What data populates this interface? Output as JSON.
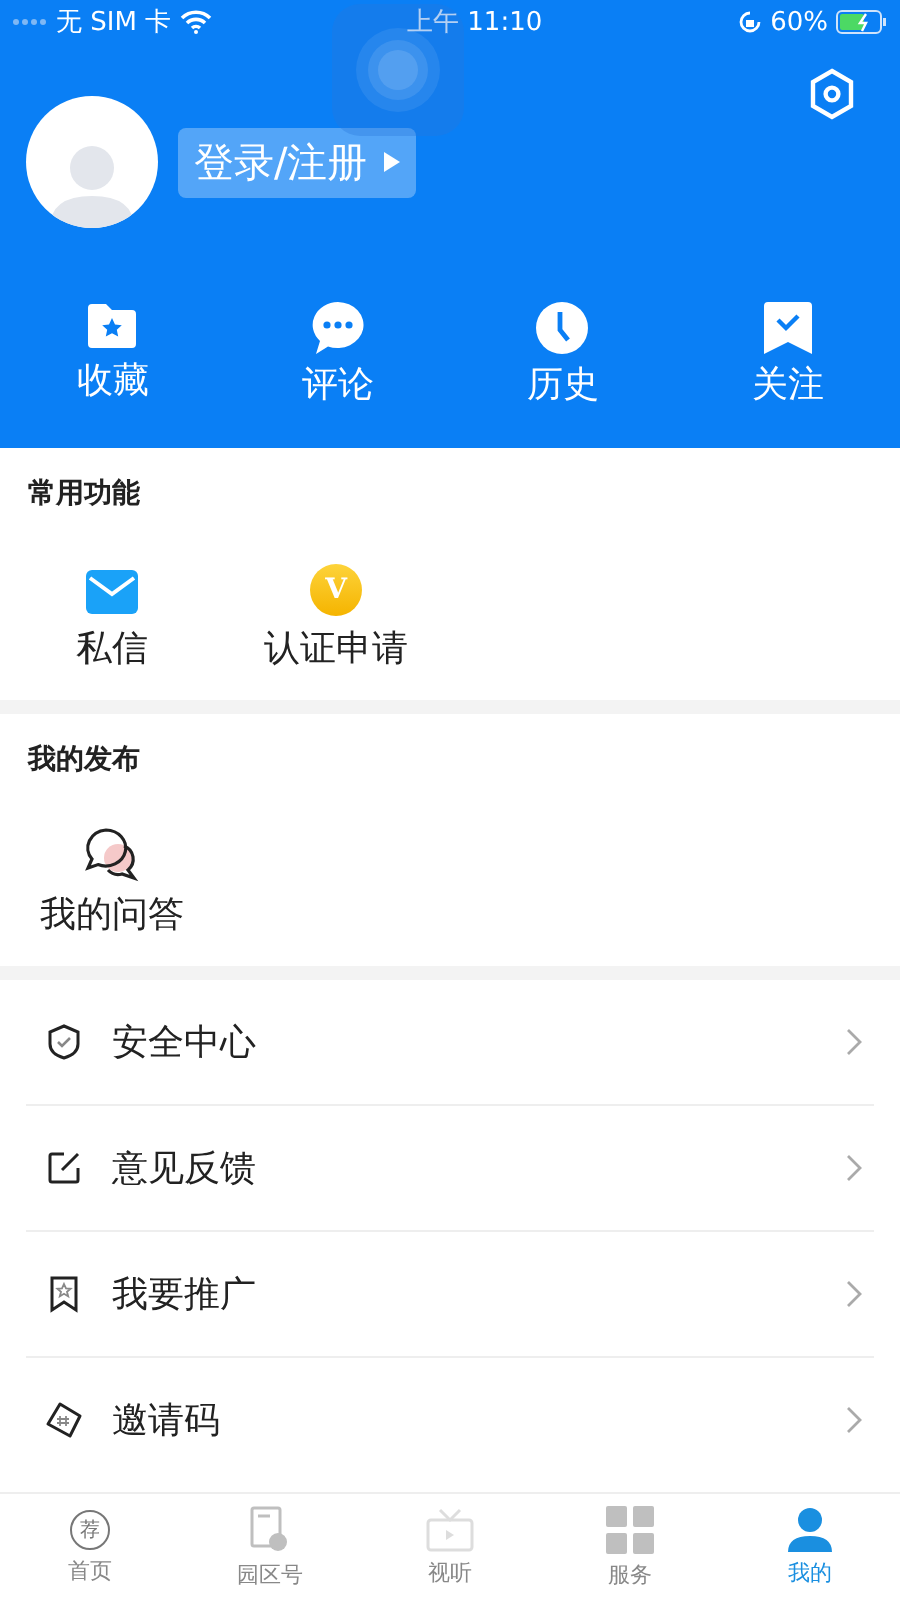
{
  "status_bar": {
    "carrier": "无 SIM 卡",
    "time": "上午 11:10",
    "battery": "60%"
  },
  "header": {
    "login_label": "登录/注册",
    "quick_links": [
      {
        "label": "收藏",
        "kind": "favorite"
      },
      {
        "label": "评论",
        "kind": "comment"
      },
      {
        "label": "历史",
        "kind": "history"
      },
      {
        "label": "关注",
        "kind": "follow"
      }
    ]
  },
  "sections": [
    {
      "title": "常用功能",
      "items": [
        {
          "label": "私信",
          "kind": "mail"
        },
        {
          "label": "认证申请",
          "kind": "verified",
          "icon_text": "V"
        }
      ]
    },
    {
      "title": "我的发布",
      "items": [
        {
          "label": "我的问答",
          "kind": "qa"
        }
      ]
    }
  ],
  "menu": [
    {
      "label": "安全中心",
      "kind": "shield"
    },
    {
      "label": "意见反馈",
      "kind": "feedback"
    },
    {
      "label": "我要推广",
      "kind": "promote"
    },
    {
      "label": "邀请码",
      "kind": "invite"
    }
  ],
  "tab_bar": [
    {
      "label": "首页",
      "kind": "home",
      "icon_text": "荐",
      "selected": false
    },
    {
      "label": "园区号",
      "kind": "park",
      "selected": false
    },
    {
      "label": "视听",
      "kind": "tv",
      "selected": false
    },
    {
      "label": "服务",
      "kind": "service",
      "selected": false
    },
    {
      "label": "我的",
      "kind": "me",
      "selected": true
    }
  ]
}
